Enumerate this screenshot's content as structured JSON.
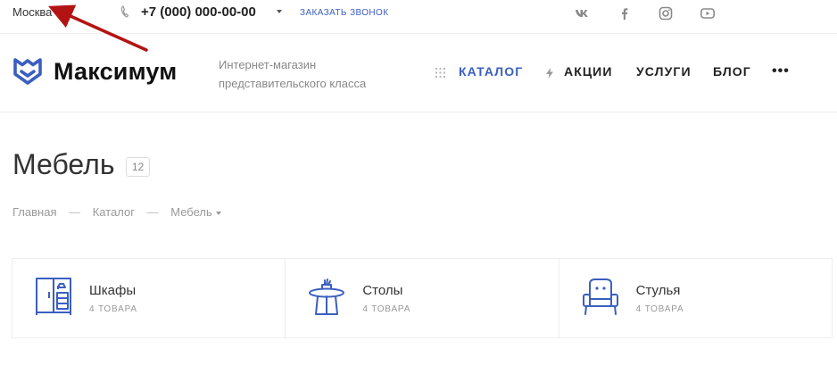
{
  "topbar": {
    "city": "Москва",
    "phone": "+7 (000) 000-00-00",
    "callback": "ЗАКАЗАТЬ ЗВОНОК",
    "social_icons": [
      "vk-icon",
      "facebook-icon",
      "instagram-icon",
      "youtube-icon"
    ]
  },
  "header": {
    "logo_text": "Максимум",
    "slogan_line1": "Интернет-магазин",
    "slogan_line2": "представительского класса",
    "nav": {
      "catalog": "КАТАЛОГ",
      "sales": "АКЦИИ",
      "services": "УСЛУГИ",
      "blog": "БЛОГ",
      "more": "•••"
    }
  },
  "page": {
    "title": "Мебель",
    "count": "12"
  },
  "breadcrumb": {
    "home": "Главная",
    "catalog": "Каталог",
    "current": "Мебель",
    "separator": "—"
  },
  "categories": [
    {
      "name": "Шкафы",
      "count": "4 ТОВАРА",
      "icon": "wardrobe-icon"
    },
    {
      "name": "Столы",
      "count": "4 ТОВАРА",
      "icon": "table-icon"
    },
    {
      "name": "Стулья",
      "count": "4 ТОВАРА",
      "icon": "chair-icon"
    }
  ],
  "colors": {
    "accent": "#3b5fc0",
    "annotation": "#b31313"
  }
}
